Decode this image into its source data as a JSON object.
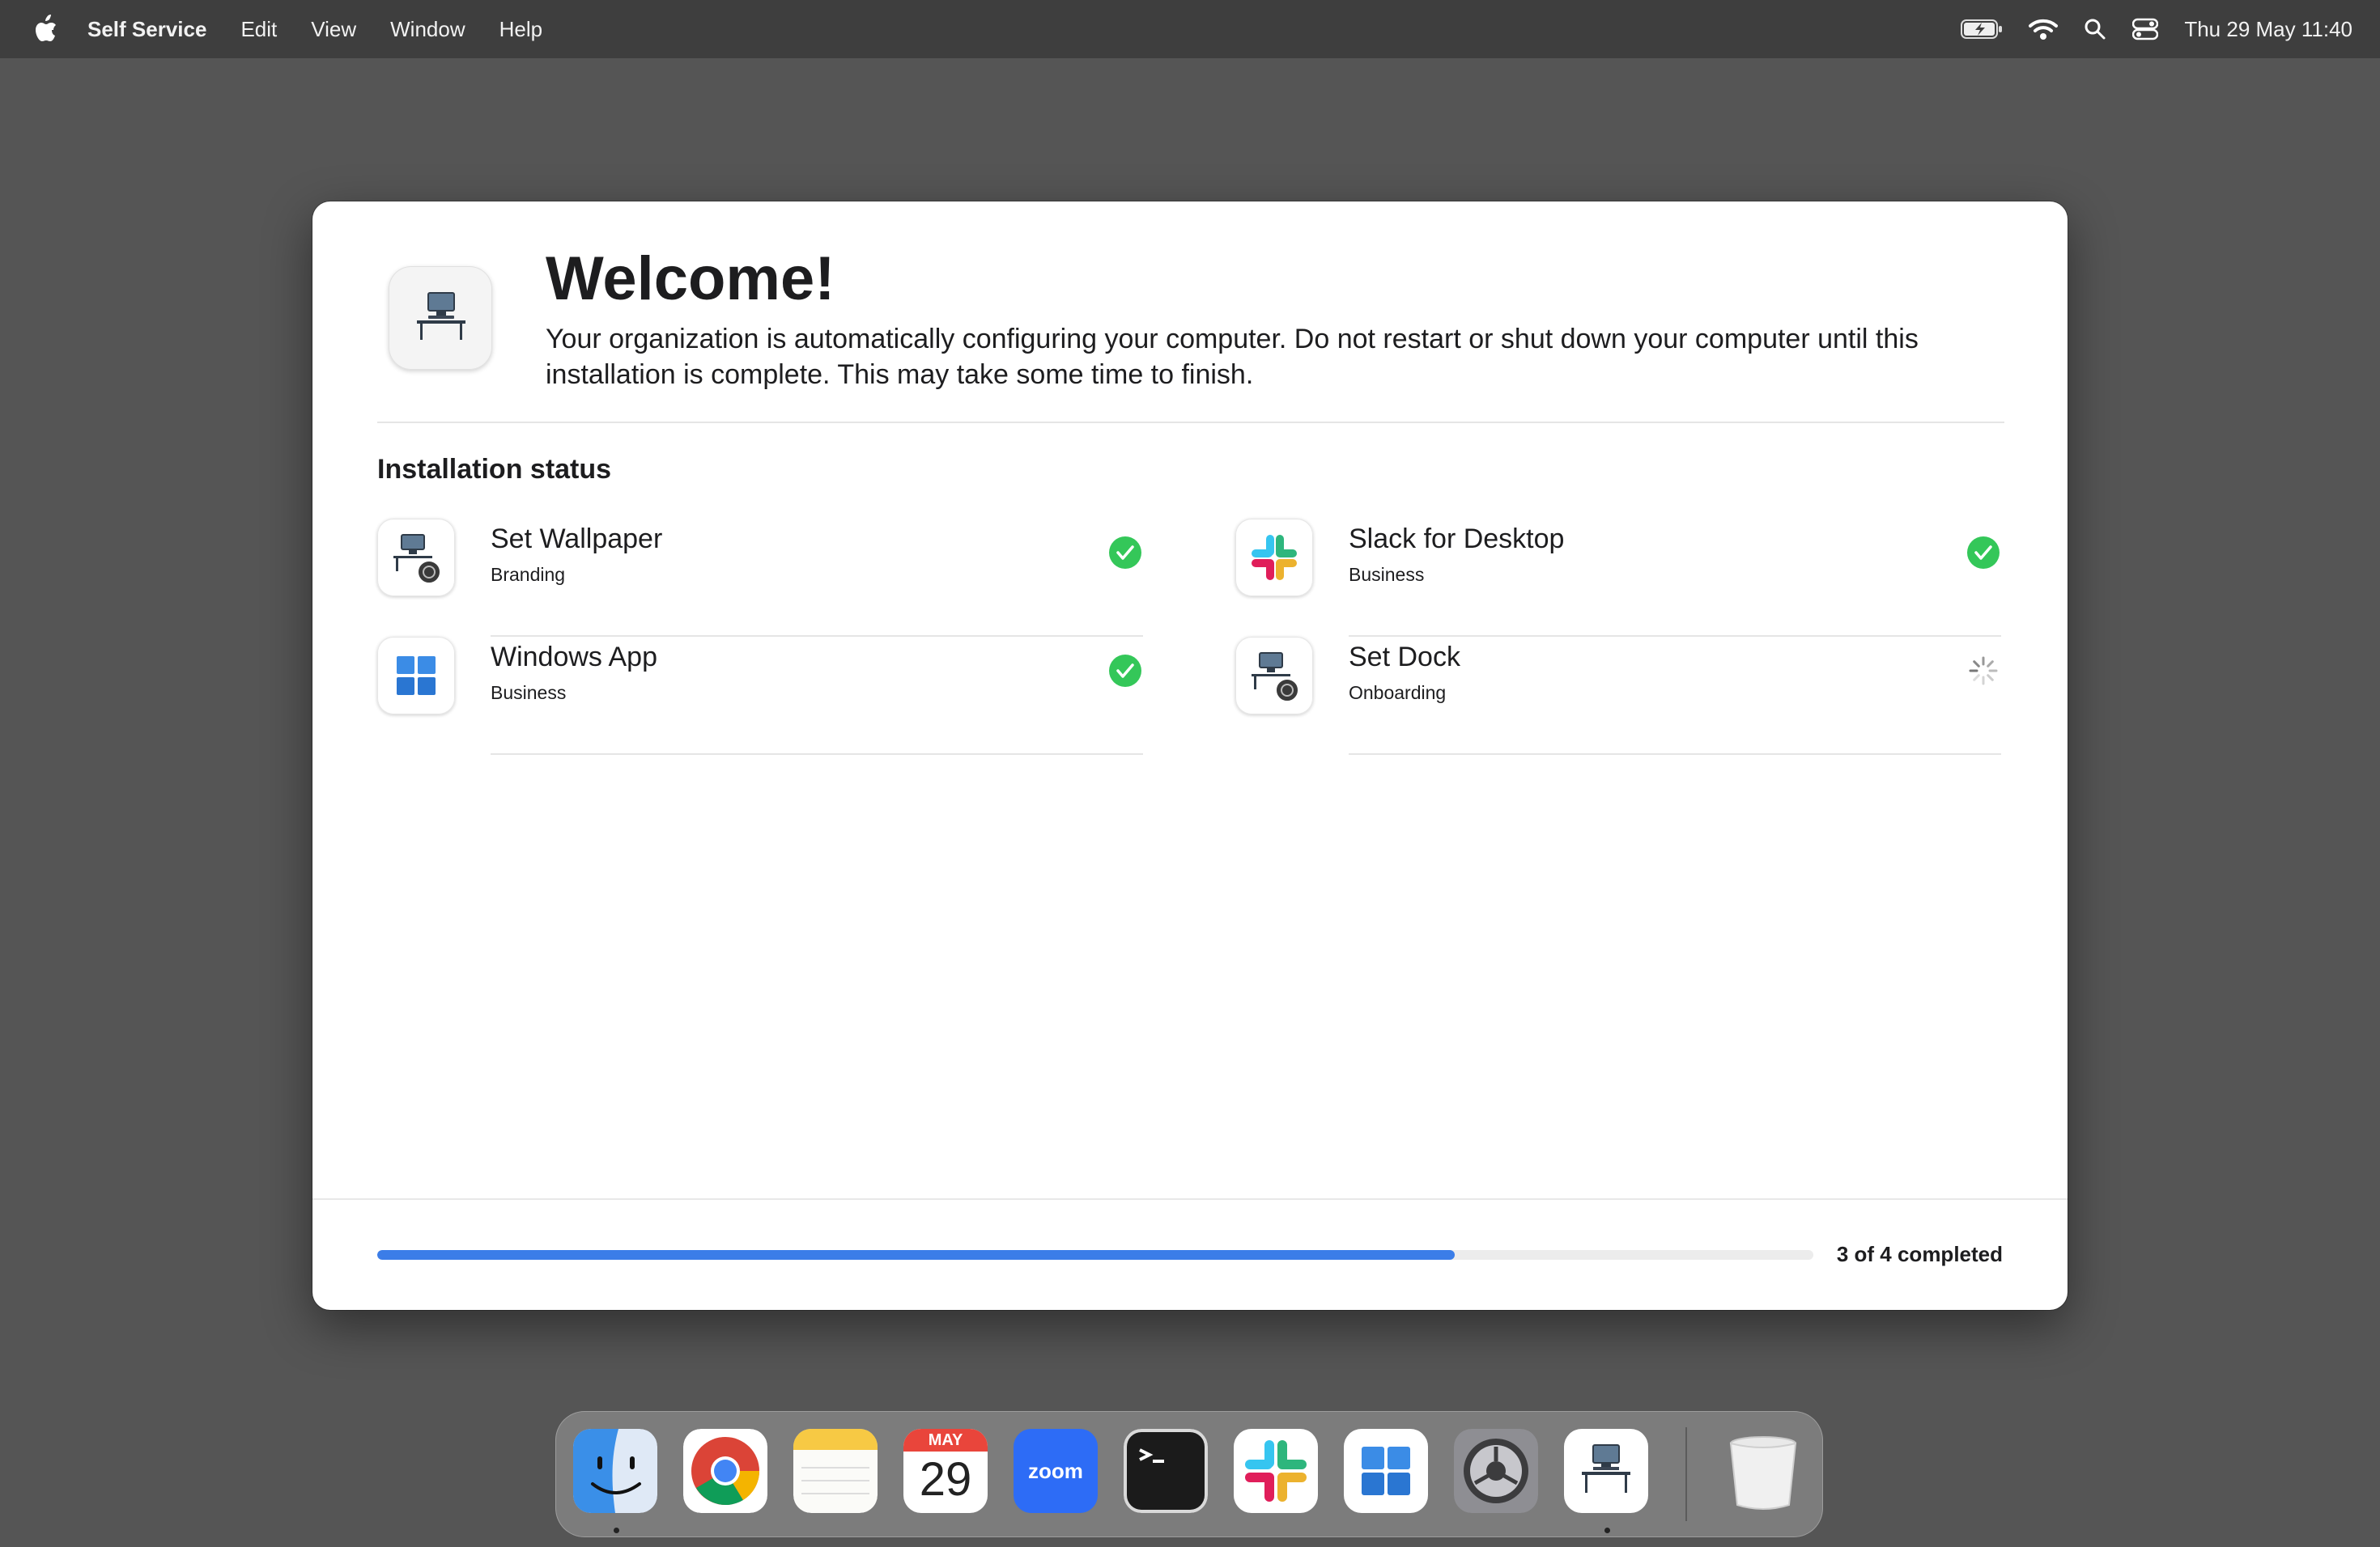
{
  "menubar": {
    "app_name": "Self Service",
    "items": [
      "Edit",
      "View",
      "Window",
      "Help"
    ],
    "status_icons": [
      "battery-charging-icon",
      "wifi-icon",
      "search-icon",
      "control-center-icon"
    ],
    "clock": "Thu 29 May  11:40"
  },
  "window": {
    "title": "Welcome!",
    "subtitle": "Your organization is automatically configuring your computer. Do not restart or shut down your computer until this installation is complete. This may take some time to finish.",
    "section_title": "Installation status",
    "items": [
      {
        "name": "Set Wallpaper",
        "category": "Branding",
        "status": "completed",
        "icon": "self-service-config-icon"
      },
      {
        "name": "Slack for Desktop",
        "category": "Business",
        "status": "completed",
        "icon": "slack-icon"
      },
      {
        "name": "Windows App",
        "category": "Business",
        "status": "completed",
        "icon": "windows-app-icon"
      },
      {
        "name": "Set Dock",
        "category": "Onboarding",
        "status": "in-progress",
        "icon": "self-service-config-icon"
      }
    ],
    "progress": {
      "completed": 3,
      "total": 4,
      "fraction": 0.75,
      "label": "3 of 4 completed"
    }
  },
  "dock": {
    "apps": [
      "finder-icon",
      "chrome-icon",
      "notes-icon",
      "calendar-icon",
      "zoom-icon",
      "terminal-icon",
      "slack-icon",
      "windows-app-icon",
      "system-settings-icon",
      "self-service-icon",
      "trash-icon"
    ],
    "calendar_month": "MAY",
    "calendar_day": "29",
    "zoom_label": "zoom"
  },
  "colors": {
    "accent": "#3b7de8",
    "success": "#34c759",
    "desktop": "#555555"
  }
}
